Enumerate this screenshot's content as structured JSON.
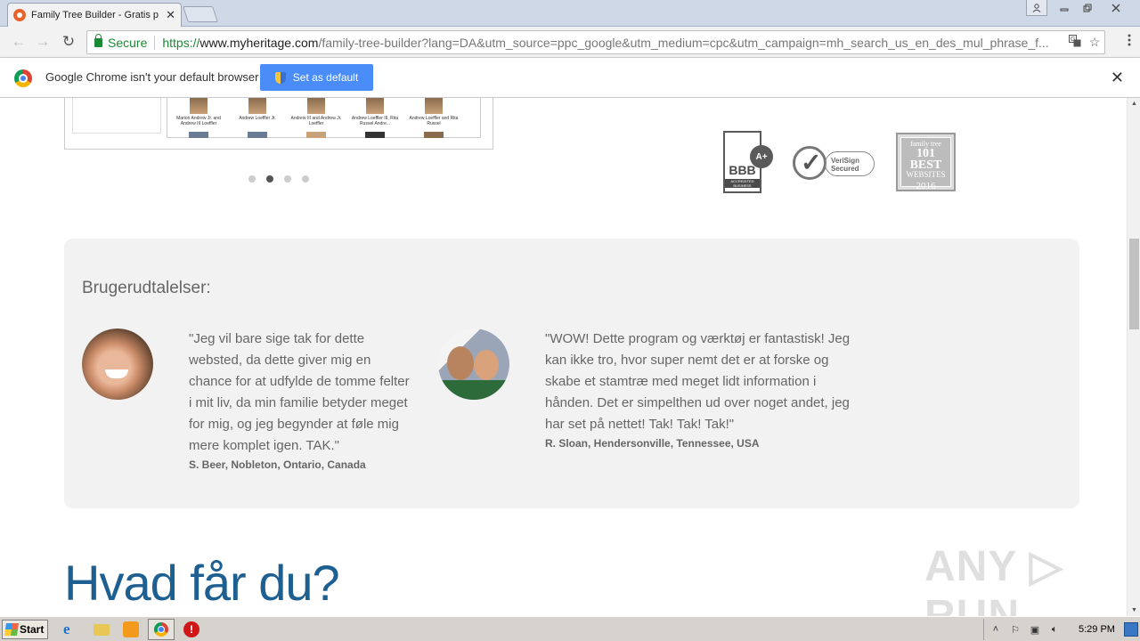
{
  "browser": {
    "tab_title": "Family Tree Builder - Gratis p",
    "tab_close": "✕",
    "secure_label": "Secure",
    "url_scheme": "https://",
    "url_host": "www.myheritage.com",
    "url_path": "/family-tree-builder?lang=DA&utm_source=ppc_google&utm_medium=cpc&utm_campaign=mh_search_us_en_des_mul_phrase_f...",
    "infobar_text": "Google Chrome isn't your default browser",
    "set_default_label": "Set as default",
    "infobar_close": "✕"
  },
  "screenshot_preview": {
    "people": [
      "Marion Andrew Jr. and Andrew III Loeffler",
      "Andrew Loeffler Jr.",
      "Andrew III and Andrew Jr. Loeffler",
      "Andrew Loeffler III, Rita Russel Andre...",
      "Andrew Loeffler and Rita Russel"
    ]
  },
  "carousel": {
    "count": 4,
    "active_index": 1
  },
  "badges": {
    "bbb": "BBB",
    "bbb_rating": "A+",
    "bbb_sub": "ACCREDITED BUSINESS",
    "verisign_line1": "VeriSign",
    "verisign_line2": "Secured",
    "fta_top": "family tree",
    "fta_big": "101 BEST",
    "fta_mid": "WEBSITES",
    "fta_year": "2016"
  },
  "testimonials": {
    "heading": "Brugerudtalelser:",
    "items": [
      {
        "quote": "\"Jeg vil bare sige tak for dette websted, da dette giver mig en chance for at udfylde de tomme felter i mit liv, da min familie betyder meget for mig, og jeg begynder at føle mig mere komplet igen. TAK.\"",
        "author": "S. Beer, Nobleton, Ontario, Canada"
      },
      {
        "quote": "\"WOW! Dette program og værktøj er fantastisk! Jeg kan ikke tro, hvor super nemt det er at forske og skabe et stamtræ med meget lidt information i hånden. Det er simpelthen ud over noget andet, jeg har set på nettet! Tak! Tak! Tak!\"",
        "author": "R. Sloan, Hendersonville, Tennessee, USA"
      }
    ]
  },
  "section_heading": "Hvad får du?",
  "watermark": "ANY ▷ RUN",
  "taskbar": {
    "start_label": "Start",
    "clock": "5:29 PM"
  },
  "colors": {
    "heading_blue": "#1e5f91",
    "button_blue": "#4a8df8",
    "secure_green": "#1a8a34"
  }
}
